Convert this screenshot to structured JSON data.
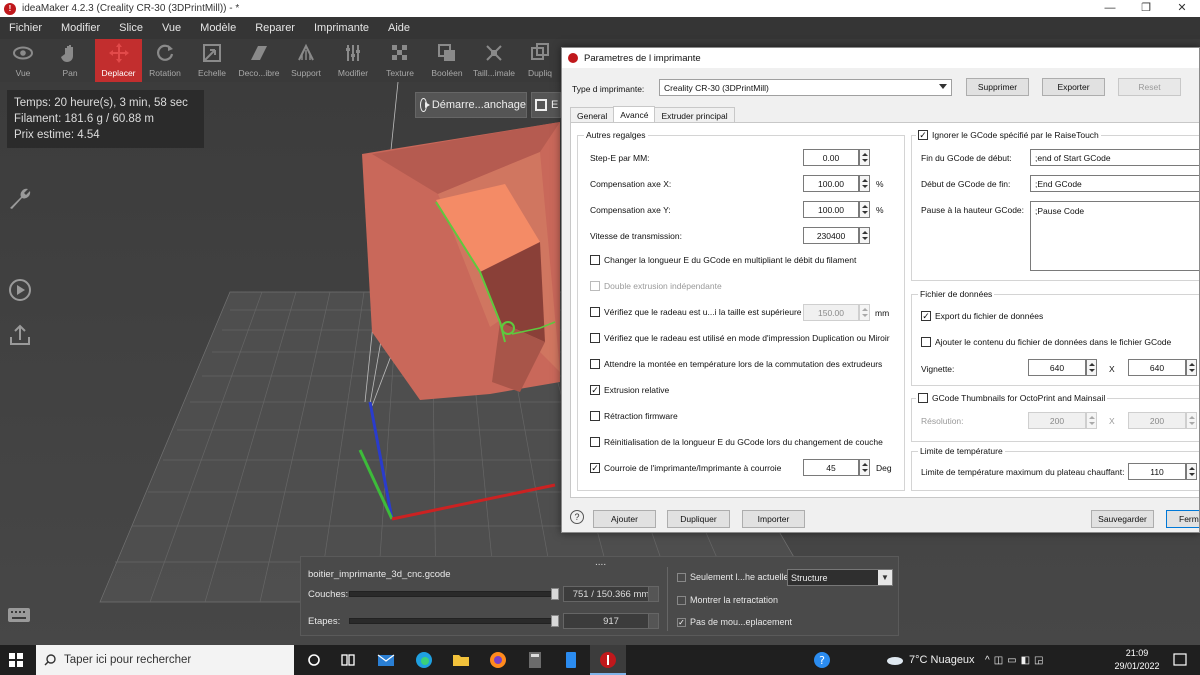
{
  "window": {
    "title": "ideaMaker 4.2.3 (Creality CR-30 (3DPrintMill)) - *",
    "minimize": "—",
    "maximize": "❐",
    "close": "✕"
  },
  "menu": [
    "Fichier",
    "Modifier",
    "Slice",
    "Vue",
    "Modèle",
    "Reparer",
    "Imprimante",
    "Aide"
  ],
  "toolbar": [
    "Vue",
    "Pan",
    "Deplacer",
    "Rotation",
    "Echelle",
    "Deco...ibre",
    "Support",
    "Modifier",
    "Texture",
    "Booléen",
    "Taill...imale",
    "Dupliq"
  ],
  "toolbar_active": "Deplacer",
  "info": {
    "time": "Temps: 20 heure(s), 3 min, 58 sec",
    "filament": "Filament: 181.6 g / 60.88 m",
    "price": "Prix estime: 4.54"
  },
  "viewport_buttons": {
    "start": "Démarre...anchage",
    "export": "E"
  },
  "layer_panel": {
    "dots": "....",
    "file": "boitier_imprimante_3d_cnc.gcode",
    "couches_label": "Couches:",
    "couches_value": "751 / 150.366 mm",
    "couches_fraction": 0.998,
    "etapes_label": "Etapes:",
    "etapes_value": "917",
    "etapes_fraction": 1.0,
    "only_current": "Seulement l...he actuelle",
    "show_retract": "Montrer la retractation",
    "no_move": "Pas de mou...eplacement",
    "structure": "Structure"
  },
  "taskbar": {
    "search": "Taper ici pour rechercher",
    "weather": "7°C Nuageux",
    "time": "21:09",
    "date": "29/01/2022"
  },
  "dialog": {
    "title": "Parametres de l imprimante",
    "printer_type_label": "Type d imprimante:",
    "printer_type_value": "Creality CR-30 (3DPrintMill)",
    "btn_delete": "Supprimer",
    "btn_export": "Exporter",
    "btn_reset": "Reset",
    "tabs": [
      "General",
      "Avancé",
      "Extruder principal"
    ],
    "active_tab": "Avancé",
    "other_settings": {
      "title": "Autres regalges",
      "step_e_label": "Step-E par MM:",
      "step_e_value": "0.00",
      "comp_x_label": "Compensation axe X:",
      "comp_x_value": "100.00",
      "comp_y_label": "Compensation axe Y:",
      "comp_y_value": "100.00",
      "baud_label": "Vitesse de transmission:",
      "baud_value": "230400",
      "percent": "%",
      "mm": "mm",
      "deg": "Deg",
      "chk_change_e": "Changer la longueur E du GCode en multipliant le débit du filament",
      "chk_double": "Double extrusion indépendante",
      "chk_raft_size": "Vérifiez que le radeau est u...i la taille est supérieure à",
      "raft_size_value": "150.00",
      "chk_raft_mode": "Vérifiez que le radeau est utilisé en mode d'impression Duplication ou Miroir",
      "chk_wait_temp": "Attendre la montée en température lors de la commutation des extrudeurs",
      "chk_relative": "Extrusion relative",
      "chk_retract_fw": "Rétraction firmware",
      "chk_reset_e": "Réinitialisation de la longueur E du GCode lors du changement de couche",
      "chk_belt": "Courroie de l'imprimante/Imprimante à courroie",
      "belt_value": "45"
    },
    "gcode": {
      "chk_ignore": "Ignorer le GCode spécifié par le RaiseTouch",
      "end_start_label": "Fin du GCode de début:",
      "end_start_value": ";end of Start GCode",
      "start_end_label": "Début de GCode de fin:",
      "start_end_value": ";End GCode",
      "pause_label": "Pause à la hauteur GCode:",
      "pause_value": ";Pause Code"
    },
    "data_file": {
      "title": "Fichier de données",
      "chk_export": "Export du fichier de données",
      "chk_add": "Ajouter le contenu du fichier de données dans le fichier GCode",
      "thumb_label": "Vignette:",
      "thumb_w": "640",
      "thumb_h": "640",
      "x": "X"
    },
    "octoprint": {
      "chk": "GCode Thumbnails for OctoPrint and Mainsail",
      "res_label": "Résolution:",
      "res_w": "200",
      "res_h": "200",
      "x": "X"
    },
    "temp_limit": {
      "title": "Limite de température",
      "label": "Limite de température maximum du plateau chauffant:",
      "value": "110"
    },
    "bottom": {
      "help": "?",
      "add": "Ajouter",
      "duplicate": "Dupliquer",
      "import": "Importer",
      "save": "Sauvegarder",
      "close": "Ferm"
    }
  }
}
